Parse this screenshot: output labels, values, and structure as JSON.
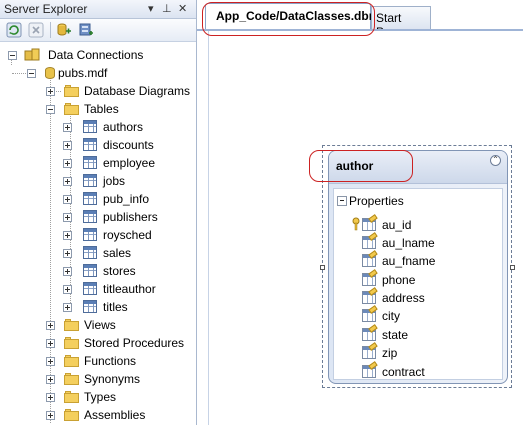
{
  "server_explorer": {
    "title": "Server Explorer",
    "title_buttons": [
      "▾",
      "⊥",
      "✕"
    ]
  },
  "tree": {
    "root": "Data Connections",
    "database": "pubs.mdf",
    "database_diagrams": "Database Diagrams",
    "tables_folder": "Tables",
    "tables": [
      "authors",
      "discounts",
      "employee",
      "jobs",
      "pub_info",
      "publishers",
      "roysched",
      "sales",
      "stores",
      "titleauthor",
      "titles"
    ],
    "other_folders": [
      "Views",
      "Stored Procedures",
      "Functions",
      "Synonyms",
      "Types",
      "Assemblies"
    ]
  },
  "tabs": {
    "active": "App_Code/DataClasses.dbml*",
    "inactive": "Start Page"
  },
  "entity": {
    "name": "author",
    "collapse_glyph": "⌃",
    "section": "Properties",
    "properties": [
      "au_id",
      "au_lname",
      "au_fname",
      "phone",
      "address",
      "city",
      "state",
      "zip",
      "contract"
    ],
    "key_property": "au_id"
  },
  "colors": {
    "annotation": "#cc2222",
    "folder": "#f4cf5e",
    "tab_border": "#8aa3c8"
  },
  "icons": {
    "refresh": "refresh-icon",
    "stop": "stop-icon",
    "connect_database": "connect-database-icon",
    "connect_server": "connect-server-icon"
  }
}
